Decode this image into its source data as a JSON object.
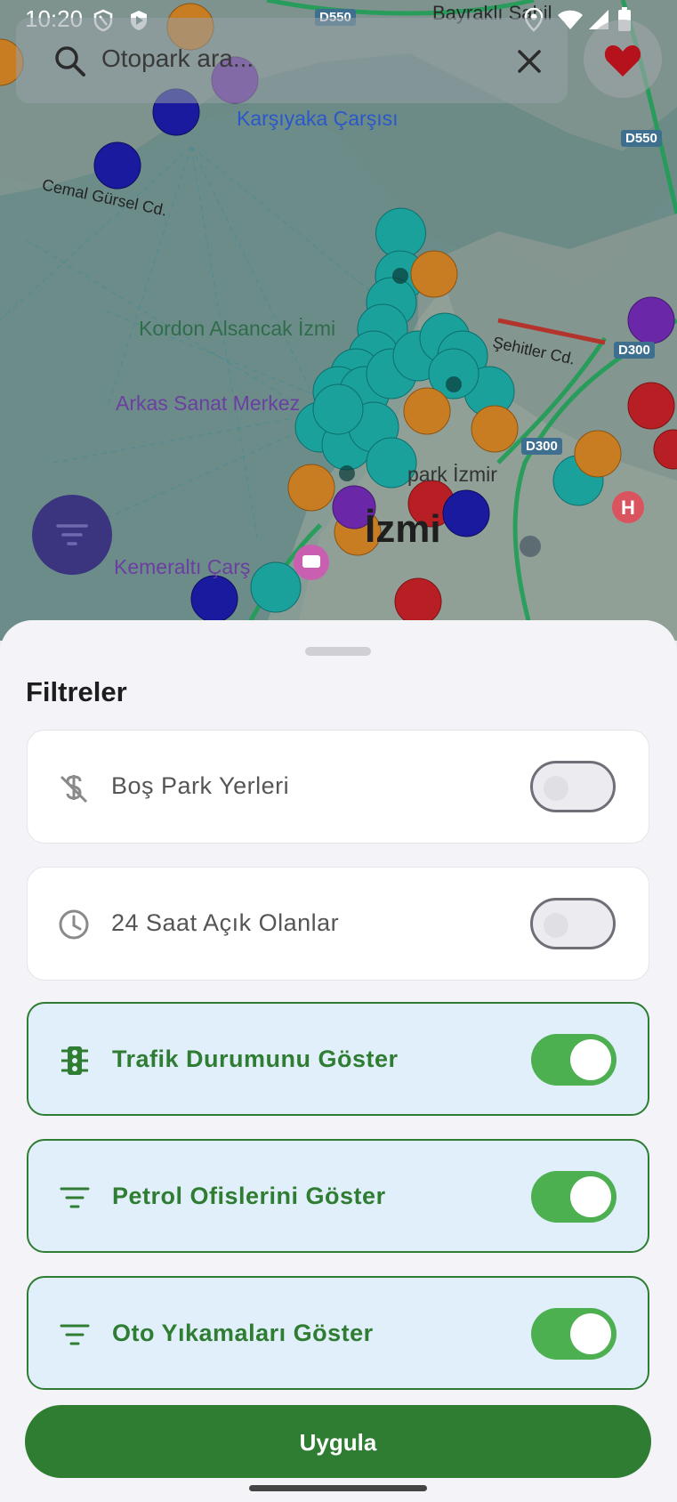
{
  "status_bar": {
    "time": "10:20"
  },
  "search": {
    "placeholder": "Otopark ara..."
  },
  "map": {
    "labels": {
      "karsiyaka": "Karşıyaka Çarşısı",
      "cemal": "Cemal Gürsel Cd.",
      "kordon": "Kordon Alsancak İzmi",
      "arkas": "Arkas Sanat Merkez",
      "sehitler": "Şehitler Cd.",
      "kemeralti": "Kemeraltı Çarş",
      "park_izmir": "park İzmir",
      "izmir_big": "İzmi",
      "bayrakli": "Bayraklı Sahil"
    },
    "roads": {
      "d550_a": "D550",
      "d550_b": "D550",
      "d300_a": "D300",
      "d300_b": "D300"
    }
  },
  "sheet": {
    "title": "Filtreler",
    "filters": [
      {
        "label": "Boş Park Yerleri",
        "icon": "money-off-icon",
        "enabled": false
      },
      {
        "label": "24 Saat Açık Olanlar",
        "icon": "clock-icon",
        "enabled": false
      },
      {
        "label": "Trafik Durumunu Göster",
        "icon": "traffic-light-icon",
        "enabled": true
      },
      {
        "label": "Petrol Ofislerini Göster",
        "icon": "filter-icon",
        "enabled": true
      },
      {
        "label": "Oto Yıkamaları Göster",
        "icon": "filter-icon",
        "enabled": true
      }
    ],
    "apply_label": "Uygula"
  },
  "colors": {
    "accent_green": "#2e7d32",
    "switch_on": "#4caf50",
    "fab_purple": "#3b3580",
    "card_active_bg": "#e1effb"
  }
}
